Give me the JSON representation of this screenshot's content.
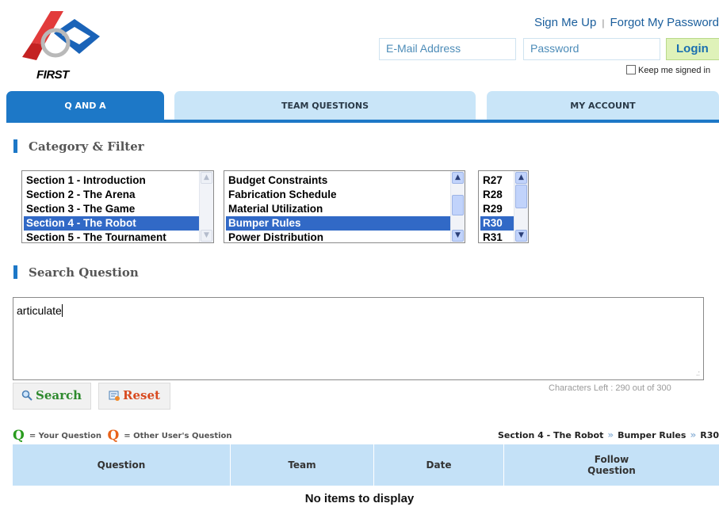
{
  "logo": {
    "text": "FIRST"
  },
  "header": {
    "sign_up": "Sign Me Up",
    "separator": "|",
    "forgot_password": "Forgot My Password",
    "email_placeholder": "E-Mail Address",
    "password_placeholder": "Password",
    "login_label": "Login",
    "keep_signed_in": "Keep me signed in"
  },
  "tabs": [
    {
      "label": "Q AND A",
      "active": true
    },
    {
      "label": "TEAM QUESTIONS",
      "active": false
    },
    {
      "label": "MY ACCOUNT",
      "active": false
    }
  ],
  "category_section": {
    "title": "Category & Filter"
  },
  "sections_list": {
    "items": [
      "Section 1 - Introduction",
      "Section 2 - The Arena",
      "Section 3 - The Game",
      "Section 4 - The Robot",
      "Section 5 - The Tournament"
    ],
    "selected": "Section 4 - The Robot"
  },
  "topics_list": {
    "items": [
      "Budget Constraints",
      "Fabrication Schedule",
      "Material Utilization",
      "Bumper Rules",
      "Power Distribution"
    ],
    "selected": "Bumper Rules"
  },
  "rules_list": {
    "items": [
      "R27",
      "R28",
      "R29",
      "R30",
      "R31"
    ],
    "selected": "R30"
  },
  "search_section": {
    "title": "Search Question",
    "query": "articulate",
    "chars_left": "Characters Left : 290 out of 300",
    "search_label": "Search",
    "reset_label": "Reset"
  },
  "legend": {
    "q": "Q",
    "your_question": "= Your Question",
    "other_question": "= Other User's Question",
    "your_color": "#2a9c1e",
    "other_color": "#e8621a"
  },
  "breadcrumb": {
    "section": "Section 4 - The Robot",
    "topic": "Bumper Rules",
    "rule": "R30",
    "sep": "»"
  },
  "table": {
    "headers": [
      "Question",
      "Team",
      "Date",
      "Follow Question"
    ],
    "empty_message": "No items to display"
  },
  "colors": {
    "accent": "#1d78c7",
    "tab_inactive": "#c9e5f8",
    "selection": "#3169c6"
  }
}
